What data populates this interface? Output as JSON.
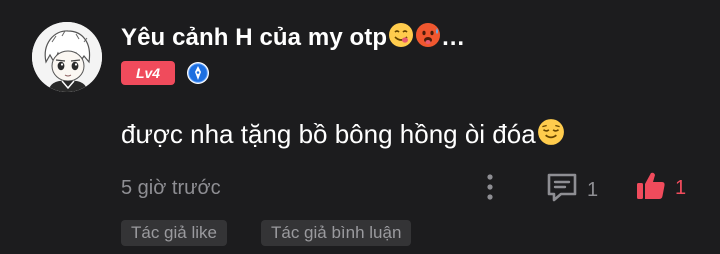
{
  "comment": {
    "username": "Yêu cảnh H của my otp",
    "username_suffix": "…",
    "username_emojis": [
      "face-savoring-food-emoji",
      "hot-face-emoji"
    ],
    "level_label": "Lv4",
    "text": "được nha tặng bồ bông hồng òi đóa",
    "text_emoji": "relieved-face-emoji",
    "timestamp": "5 giờ trước",
    "reply_count": "1",
    "like_count": "1",
    "tags": [
      "Tác giả like",
      "Tác giả bình luận"
    ]
  },
  "colors": {
    "background": "#1c1c1e",
    "accent": "#f04b5c",
    "secondary_text": "#8e8e93",
    "tag_background": "#343436",
    "verified_blue": "#1d6fe0"
  },
  "icons": [
    "avatar-image",
    "verified-badge-icon",
    "more-vertical-icon",
    "reply-comment-icon",
    "thumbs-up-icon"
  ]
}
